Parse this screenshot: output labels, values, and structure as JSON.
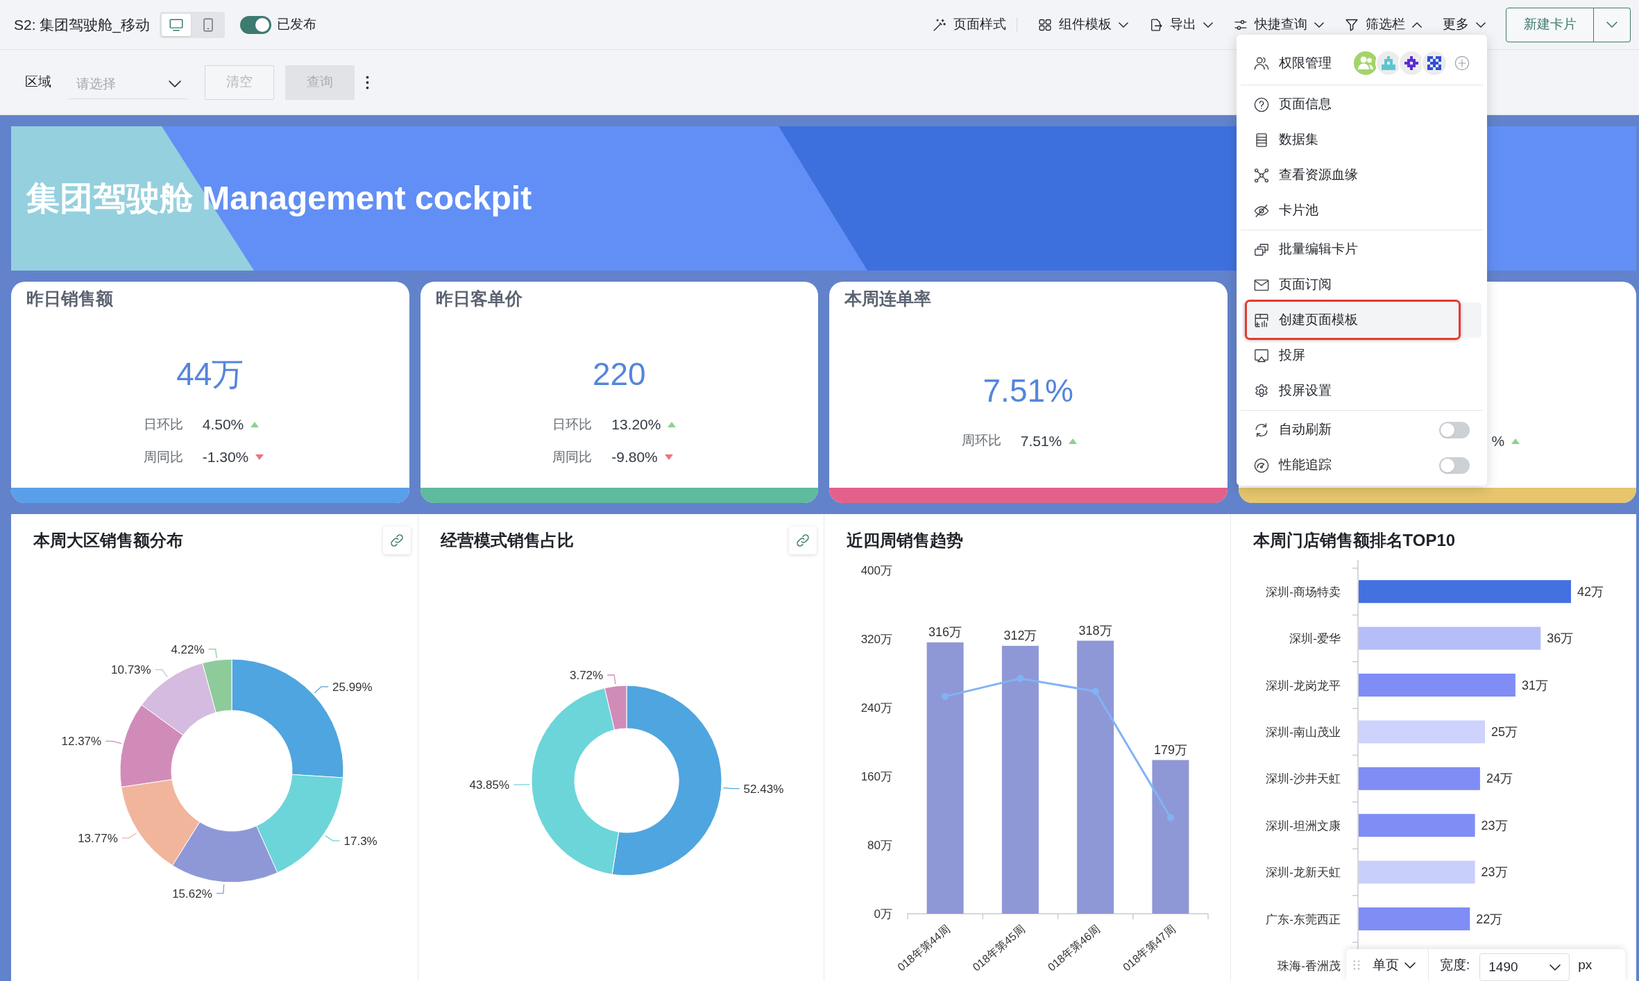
{
  "header": {
    "title": "S2: 集团驾驶舱_移动",
    "view_modes": [
      {
        "selected": true
      },
      {
        "selected": false
      }
    ],
    "publish": {
      "on": true,
      "label": "已发布"
    },
    "toolbar": [
      {
        "label": "页面样式",
        "kind": "button"
      },
      {
        "label": "组件模板",
        "kind": "dropdown",
        "expanded": false
      },
      {
        "label": "导出",
        "kind": "dropdown",
        "expanded": false
      },
      {
        "label": "快捷查询",
        "kind": "dropdown",
        "expanded": false
      },
      {
        "label": "筛选栏",
        "kind": "dropdown",
        "expanded": true
      },
      {
        "label": "更多",
        "kind": "dropdown",
        "expanded": false
      }
    ],
    "new_card_button": {
      "label": "新建卡片"
    }
  },
  "filter_bar": {
    "label": "区域",
    "placeholder": "请选择",
    "buttons": [
      {
        "label": "清空",
        "kind": "outline",
        "disabled": true
      },
      {
        "label": "查询",
        "kind": "filled",
        "disabled": true
      }
    ]
  },
  "banner": {
    "title": "集团驾驶舱 Management cockpit"
  },
  "kpi_cards": [
    {
      "title": "昨日销售额",
      "value": "44万",
      "color": "#5a9fea",
      "rows": [
        {
          "label": "日环比",
          "value": "4.50%",
          "up": true
        },
        {
          "label": "周同比",
          "value": "-1.30%",
          "up": false
        }
      ]
    },
    {
      "title": "昨日客单价",
      "value": "220",
      "color": "#5fba9e",
      "rows": [
        {
          "label": "日环比",
          "value": "13.20%",
          "up": true
        },
        {
          "label": "周同比",
          "value": "-9.80%",
          "up": false
        }
      ]
    },
    {
      "title": "本周连单率",
      "value": "7.51%",
      "color": "#e3608b",
      "rows": [
        {
          "label": "周环比",
          "value": "7.51%",
          "up": true
        }
      ]
    },
    {
      "color": "#e6c56c",
      "rows": [
        {
          "value": "%",
          "up": true
        }
      ]
    }
  ],
  "charts": [
    {
      "title": "本周大区销售额分布",
      "link_button": true,
      "chart_data": {
        "type": "donut",
        "values": [
          25.99,
          17.3,
          15.62,
          13.77,
          12.37,
          10.73,
          4.22
        ],
        "colors": [
          "#4fa5df",
          "#6cd5d9",
          "#8e98d7",
          "#f1b59c",
          "#d18bb9",
          "#d4bbdf",
          "#8ecb9b"
        ],
        "value_labels": [
          "25.99%",
          "17.3%",
          "15.62%",
          "13.77%",
          "12.37%",
          "10.73%",
          "4.22%"
        ]
      }
    },
    {
      "title": "经营模式销售占比",
      "link_button": true,
      "chart_data": {
        "type": "donut",
        "values": [
          52.43,
          43.85,
          3.72
        ],
        "colors": [
          "#4fa5df",
          "#6cd5d9",
          "#d18bb9"
        ],
        "value_labels": [
          "52.43%",
          "43.85%",
          "3.72%"
        ]
      }
    },
    {
      "title": "近四周销售趋势",
      "link_button": false,
      "chart_data": {
        "type": "bar",
        "categories": [
          "018年第44周",
          "018年第45周",
          "018年第46周",
          "018年第47周"
        ],
        "series": [
          {
            "type": "bar",
            "color": "#8f98d6",
            "values": [
              316,
              312,
              318,
              179
            ],
            "value_labels": [
              "316万",
              "312万",
              "318万",
              "179万"
            ]
          },
          {
            "type": "line",
            "color": "#80b3f6",
            "marker": true,
            "values": [
              253,
              274,
              259,
              112
            ]
          }
        ],
        "ylim": [
          0,
          400
        ],
        "yticks": [
          {
            "value": 0,
            "label": "0万"
          },
          {
            "value": 80,
            "label": "80万"
          },
          {
            "value": 160,
            "label": "160万"
          },
          {
            "value": 240,
            "label": "240万"
          },
          {
            "value": 320,
            "label": "320万"
          },
          {
            "value": 400,
            "label": "400万"
          }
        ]
      }
    },
    {
      "title": "本周门店销售额排名TOP10",
      "link_button": false,
      "chart_data": {
        "type": "bar",
        "orientation": "horizontal",
        "categories": [
          "深圳-商场特卖",
          "深圳-爱华",
          "深圳-龙岗龙平",
          "深圳-南山茂业",
          "深圳-沙井天虹",
          "深圳-坦洲文康",
          "深圳-龙新天虹",
          "广东-东莞西正",
          "珠海-香洲茂"
        ],
        "series": [
          {
            "values": [
              42,
              36,
              31,
              25,
              24,
              23,
              23,
              22,
              null
            ],
            "colors": [
              "#4471e0",
              "#b6bef9",
              "#7f8df5",
              "#cdd3fc",
              "#7f8df5",
              "#7f8df5",
              "#c9cffb",
              "#7f8df5",
              null
            ],
            "value_labels": [
              "42万",
              "36万",
              "31万",
              "25万",
              "24万",
              "23万",
              "23万",
              "22万",
              null
            ]
          }
        ]
      }
    }
  ],
  "more_menu": {
    "groups": [
      [
        {
          "label": "权限管理",
          "kind": "avatars",
          "highlighted": false,
          "avatars": [
            {
              "kind": "group",
              "color": "#a3d46a"
            },
            {
              "kind": "identicon",
              "color": "#5cc6d0"
            },
            {
              "kind": "identicon",
              "color": "#5b2bd6"
            },
            {
              "kind": "identicon",
              "color": "#2f4fd8"
            }
          ]
        }
      ],
      [
        {
          "label": "页面信息",
          "kind": "item",
          "highlighted": false
        },
        {
          "label": "数据集",
          "kind": "item",
          "highlighted": false
        },
        {
          "label": "查看资源血缘",
          "kind": "item",
          "highlighted": false
        },
        {
          "label": "卡片池",
          "kind": "item",
          "highlighted": false
        }
      ],
      [
        {
          "label": "批量编辑卡片",
          "kind": "item",
          "highlighted": false
        },
        {
          "label": "页面订阅",
          "kind": "item",
          "highlighted": false
        },
        {
          "label": "创建页面模板",
          "kind": "item",
          "highlighted": true
        },
        {
          "label": "投屏",
          "kind": "item",
          "highlighted": false
        },
        {
          "label": "投屏设置",
          "kind": "item",
          "highlighted": false
        }
      ],
      [
        {
          "label": "自动刷新",
          "kind": "toggle",
          "on": false,
          "highlighted": false
        },
        {
          "label": "性能追踪",
          "kind": "toggle",
          "on": false,
          "highlighted": false
        }
      ]
    ]
  },
  "bottom_toolbar": {
    "page_mode": "单页",
    "width_label": "宽度:",
    "width_value": "1490",
    "unit": "px"
  }
}
